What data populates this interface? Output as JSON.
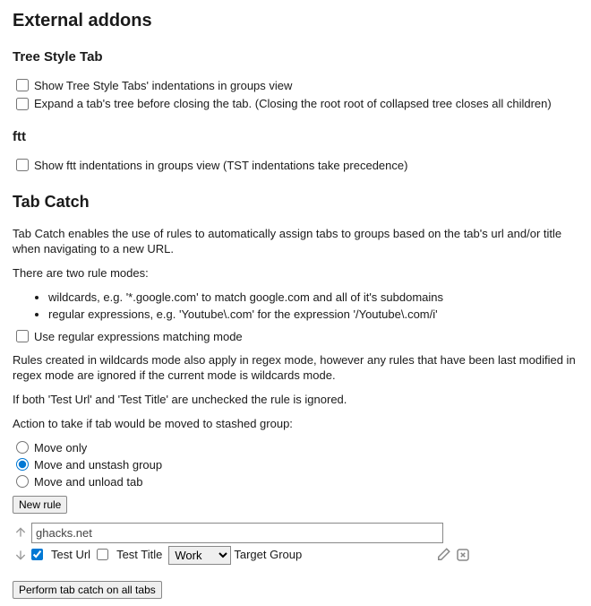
{
  "header": {
    "title": "External addons"
  },
  "tst": {
    "heading": "Tree Style Tab",
    "show_indent": "Show Tree Style Tabs' indentations in groups view",
    "expand_before_close": "Expand a tab's tree before closing the tab. (Closing the root root of collapsed tree closes all children)"
  },
  "ftt": {
    "heading": "ftt",
    "show_indent": "Show ftt indentations in groups view (TST indentations take precedence)"
  },
  "tabcatch": {
    "heading": "Tab Catch",
    "desc": "Tab Catch enables the use of rules to automatically assign tabs to groups based on the tab's url and/or title when navigating to a new URL.",
    "modes_intro": "There are two rule modes:",
    "mode1": "wildcards, e.g. '*.google.com' to match google.com and all of it's subdomains",
    "mode2": "regular expressions, e.g. 'Youtube\\.com' for the expression '/Youtube\\.com/i'",
    "use_regex": "Use regular expressions matching mode",
    "regex_note": "Rules created in wildcards mode also apply in regex mode, however any rules that have been last modified in regex mode are ignored if the current mode is wildcards mode.",
    "ignored_note": "If both 'Test Url' and 'Test Title' are unchecked the rule is ignored.",
    "action_label": "Action to take if tab would be moved to stashed group:",
    "opt1": "Move only",
    "opt2": "Move and unstash group",
    "opt3": "Move and unload tab",
    "new_rule": "New rule",
    "perform": "Perform tab catch on all tabs"
  },
  "rule": {
    "pattern": "ghacks.net",
    "test_url": "Test Url",
    "test_title": "Test Title",
    "target_group": "Target Group",
    "selected_group": "Work"
  }
}
